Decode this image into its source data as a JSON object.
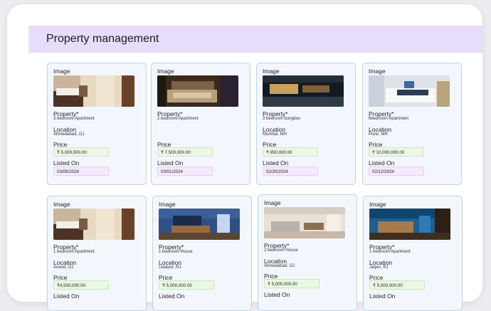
{
  "page": {
    "title": "Property management"
  },
  "field_labels": {
    "image": "Image",
    "property": "Property*",
    "location": "Location",
    "price": "Price",
    "listed_on": "Listed On"
  },
  "currency_symbol": "₹",
  "cards": [
    {
      "image_icon": "bedroom-photo",
      "property": "3 bedroom Apartment",
      "location": "Ahmedabad, GJ",
      "price": "₹ 5,000,000.00",
      "listed_on": "03/08/2024"
    },
    {
      "image_icon": "bedroom-photo",
      "property": "2 bedroom Apartment",
      "location": "",
      "price": "₹ 7,500,000.00",
      "listed_on": "03/01/2024"
    },
    {
      "image_icon": "house-exterior-photo",
      "property": "3 bedroom bunglow",
      "location": "Mumbai, MH",
      "price": "₹ 850,000.00",
      "listed_on": "02/20/2024"
    },
    {
      "image_icon": "bedroom-photo",
      "property": "6bedroom Apartment",
      "location": "Pune, MH",
      "price": "₹ 10,000,000.00",
      "listed_on": "02/12/2024"
    },
    {
      "image_icon": "bedroom-photo",
      "property": "1 bedroom Apartment",
      "location": "Anand, GJ",
      "price": "₹4,500,000.00",
      "listed_on": ""
    },
    {
      "image_icon": "living-room-photo",
      "property": "1 bedroom House",
      "location": "Udaipur, RJ",
      "price": "₹ 5,000,000.00",
      "listed_on": ""
    },
    {
      "image_icon": "living-room-photo",
      "property": "2 bedroom House",
      "location": "Ahmedabad, GJ",
      "price": "₹ 5,000,000.00",
      "listed_on": ""
    },
    {
      "image_icon": "living-room-photo",
      "property": "1 bedroom Apartment",
      "location": "Jaipur, RJ",
      "price": "₹ 5,000,000.00",
      "listed_on": ""
    }
  ]
}
